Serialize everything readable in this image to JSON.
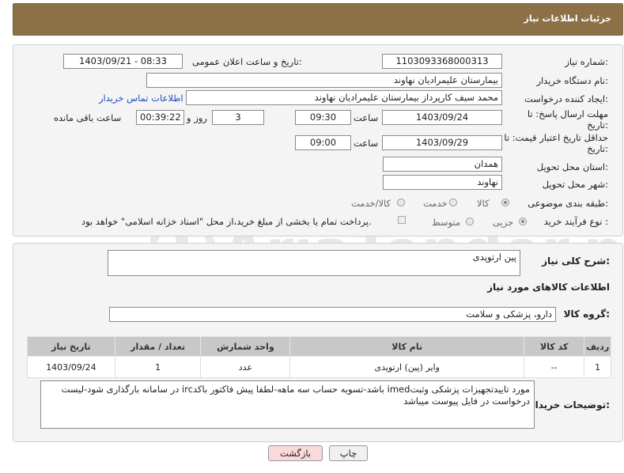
{
  "header": {
    "title": "جزئیات اطلاعات نیاز"
  },
  "form": {
    "need_number_label": "شماره نیاز:",
    "need_number": "1103093368000313",
    "announce_label": "تاریخ و ساعت اعلان عمومی:",
    "announce_value": "1403/09/21 - 08:33",
    "buyer_org_label": "نام دستگاه خریدار:",
    "buyer_org": "بیمارستان علیمرادیان نهاوند",
    "creator_label": "ایجاد کننده درخواست:",
    "creator": "محمد سیف کارپرداز بیمارستان علیمرادیان نهاوند",
    "contact_link": "اطلاعات تماس خریدار",
    "deadline_label_1": "مهلت ارسال پاسخ: تا",
    "deadline_label_2": "تاریخ:",
    "deadline_date": "1403/09/24",
    "time_label": "ساعت",
    "deadline_time": "09:30",
    "days_value": "3",
    "days_label": "روز و",
    "remaining_value": "00:39:22",
    "remaining_label": "ساعت باقی مانده",
    "price_label_1": "حداقل تاریخ اعتبار قیمت: تا",
    "price_label_2": "تاریخ:",
    "price_date": "1403/09/29",
    "price_time_label": "ساعت",
    "price_time": "09:00",
    "province_label": "استان محل تحویل:",
    "province": "همدان",
    "city_label": "شهر محل تحویل:",
    "city": "نهاوند",
    "category_label": "طبقه بندی موضوعی:",
    "category_options": [
      "کالا",
      "خدمت",
      "کالا/خدمت"
    ],
    "process_label": "نوع فرآیند خرید :",
    "process_options": [
      "جزیی",
      "متوسط"
    ],
    "payment_note": "پرداخت تمام یا بخشی از مبلغ خرید،از محل \"اسناد خزانه اسلامی\" خواهد بود."
  },
  "details": {
    "summary_label": "شرح کلی نیاز:",
    "summary": "پین ارتوپدی",
    "goods_info_title": "اطلاعات کالاهای مورد نیاز",
    "goods_group_label": "گروه کالا:",
    "goods_group": "دارو، پزشکی و سلامت",
    "table_headers": [
      "ردیف",
      "کد کالا",
      "نام کالا",
      "واحد شمارش",
      "تعداد / مقدار",
      "تاریخ نیاز"
    ],
    "rows": [
      [
        "1",
        "--",
        "وایر (پین) ارتوپدی",
        "عدد",
        "1",
        "1403/09/24"
      ]
    ],
    "buyer_notes_label": "توضیحات خریدار:",
    "buyer_notes": "مورد تاییدتجهیزات پزشکی وثبتimed باشد-تسویه حساب سه ماهه-لطفا پیش فاکتور باکدirc در سامانه بارگذاری شود-لیست درخواست در فایل پیوست میباشد"
  },
  "buttons": {
    "print": "چاپ",
    "back": "بازگشت"
  },
  "watermark": "AriaTender.neT",
  "colors": {
    "header_bg": "#8c7147",
    "panel_bg": "#f4f4f4",
    "link": "#1a4fc0",
    "back_btn": "#f9d9d9"
  }
}
